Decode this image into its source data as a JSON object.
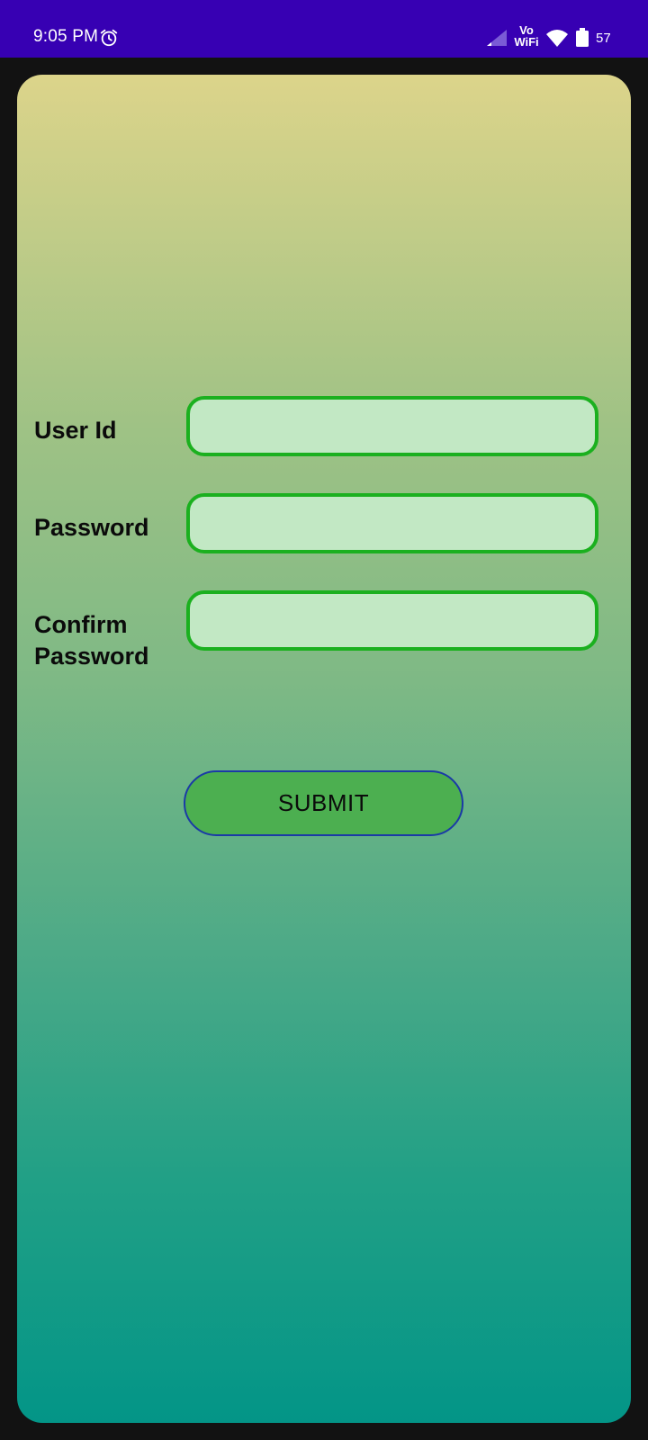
{
  "status_bar": {
    "time": "9:05 PM",
    "network_label_top": "Vo",
    "network_label_bottom": "WiFi",
    "battery": "57",
    "icons": [
      "alarm-icon",
      "signal-icon",
      "wifi-icon",
      "battery-icon"
    ],
    "background_color": "#3700b3"
  },
  "form": {
    "fields": [
      {
        "label_line1": "User Id",
        "label_line2": "",
        "value": "",
        "placeholder": ""
      },
      {
        "label_line1": "Password",
        "label_line2": "",
        "value": "",
        "placeholder": ""
      },
      {
        "label_line1": "Confirm",
        "label_line2": "Password",
        "value": "",
        "placeholder": ""
      }
    ],
    "submit_label": "SUBMIT"
  },
  "colors": {
    "input_border": "#1bb01f",
    "input_fill": "#c2e8c4",
    "button_fill": "#4caf50",
    "button_border": "#1a3aa6",
    "gradient_top": "#dcd48a",
    "gradient_bottom": "#039587"
  }
}
